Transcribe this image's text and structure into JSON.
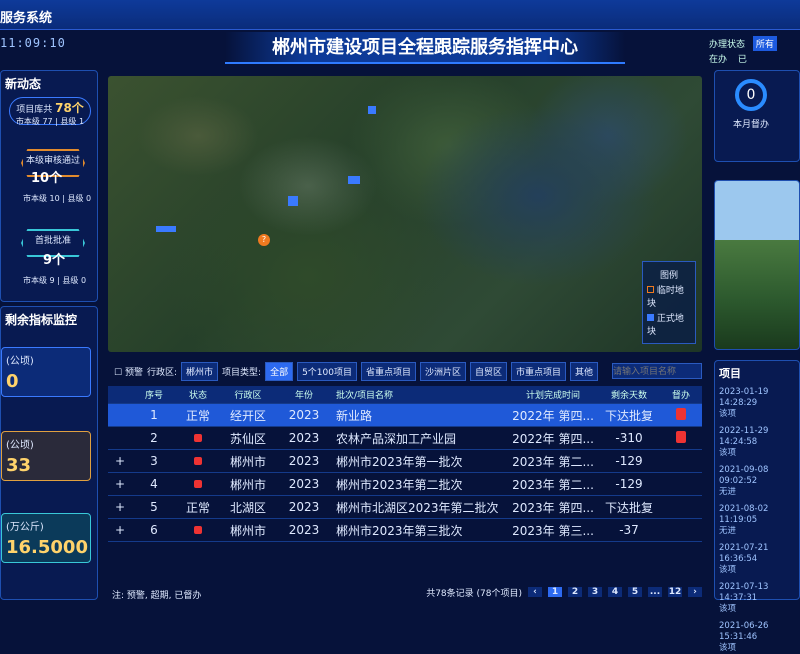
{
  "header": {
    "system": "服务系统",
    "clock": "11:09:10",
    "title": "郴州市建设项目全程跟踪服务指挥中心",
    "filter": {
      "label": "办理状态",
      "options": [
        "所有",
        "在办",
        "已"
      ]
    }
  },
  "left": {
    "dynamics_title": "新动态",
    "pool": {
      "label": "项目库共",
      "value": "78个",
      "sub": "市本级 77 | 县级 1"
    },
    "review": {
      "label": "本级审核通过",
      "value": "10个",
      "sub": "市本级 10 | 县级 0"
    },
    "first": {
      "label": "首批批准",
      "value": "9个",
      "sub": "市本级 9 | 县级 0"
    },
    "remain_title": "剩余指标监控",
    "kpi1": {
      "label": "(公顷)",
      "value": "0"
    },
    "kpi2": {
      "label": "(公顷)",
      "value": "33"
    },
    "kpi3": {
      "label": "(万公斤)",
      "value": "16.5000"
    }
  },
  "map": {
    "legend_title": "图例",
    "legend": [
      "临时地块",
      "正式地块"
    ]
  },
  "toolbar": {
    "warn": "预警",
    "district_label": "行政区:",
    "district": "郴州市",
    "type_label": "项目类型:",
    "types": [
      "全部",
      "5个100项目",
      "省重点项目",
      "沙洲片区",
      "自贸区",
      "市重点项目",
      "其他"
    ],
    "search_placeholder": "请输入项目名称"
  },
  "table": {
    "headers": [
      "序号",
      "状态",
      "行政区",
      "年份",
      "批次/项目名称",
      "计划完成时间",
      "剩余天数",
      "督办"
    ],
    "rows": [
      {
        "no": "1",
        "status": "正常",
        "district": "经开区",
        "year": "2023",
        "name": "新业路",
        "plan": "2022年 第四...",
        "days": "下达批复"
      },
      {
        "no": "2",
        "status": "",
        "district": "苏仙区",
        "year": "2023",
        "name": "农林产品深加工产业园",
        "plan": "2022年 第四...",
        "days": "-310"
      },
      {
        "no": "3",
        "status": "",
        "district": "郴州市",
        "year": "2023",
        "name": "郴州市2023年第一批次",
        "plan": "2023年 第二...",
        "days": "-129"
      },
      {
        "no": "4",
        "status": "",
        "district": "郴州市",
        "year": "2023",
        "name": "郴州市2023年第二批次",
        "plan": "2023年 第二...",
        "days": "-129"
      },
      {
        "no": "5",
        "status": "正常",
        "district": "北湖区",
        "year": "2023",
        "name": "郴州市北湖区2023年第二批次",
        "plan": "2023年 第四...",
        "days": "下达批复"
      },
      {
        "no": "6",
        "status": "",
        "district": "郴州市",
        "year": "2023",
        "name": "郴州市2023年第三批次",
        "plan": "2023年 第三...",
        "days": "-37"
      }
    ]
  },
  "footer": {
    "note": "注: 预警, 超期, 已督办",
    "records": "共78条记录 (78个项目)",
    "pages": [
      "1",
      "2",
      "3",
      "4",
      "5",
      "...",
      "12"
    ]
  },
  "right": {
    "ring_value": "0",
    "ring_label": "本月督办",
    "timeline_title": "项目",
    "timeline": [
      {
        "date": "2023-01-19",
        "time": "14:28:29",
        "text": "该项"
      },
      {
        "date": "2022-11-29",
        "time": "14:24:58",
        "text": "该项"
      },
      {
        "date": "2021-09-08",
        "time": "09:02:52",
        "text": "无进"
      },
      {
        "date": "2021-08-02",
        "time": "11:19:05",
        "text": "无进"
      },
      {
        "date": "2021-07-21",
        "time": "16:36:54",
        "text": "该项"
      },
      {
        "date": "2021-07-13",
        "time": "14:37:31",
        "text": "该项"
      },
      {
        "date": "2021-06-26",
        "time": "15:31:46",
        "text": "该项"
      }
    ]
  }
}
